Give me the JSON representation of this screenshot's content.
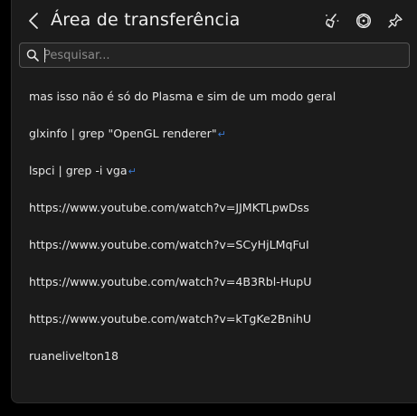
{
  "header": {
    "title": "Área de transferência",
    "back_icon": "back-arrow-icon",
    "clear_icon": "clear-history-icon",
    "configure_icon": "settings-icon",
    "pin_icon": "pin-icon"
  },
  "search": {
    "placeholder": "Pesquisar...",
    "value": ""
  },
  "items": [
    {
      "text": "mas isso não é só do Plasma e sim de um modo geral",
      "newline": false
    },
    {
      "text": "glxinfo | grep \"OpenGL renderer\"",
      "newline": true
    },
    {
      "text": "lspci | grep -i vga",
      "newline": true
    },
    {
      "text": "https://www.youtube.com/watch?v=JJMKTLpwDss",
      "newline": false
    },
    {
      "text": "https://www.youtube.com/watch?v=SCyHjLMqFuI",
      "newline": false
    },
    {
      "text": "https://www.youtube.com/watch?v=4B3Rbl-HupU",
      "newline": false
    },
    {
      "text": "https://www.youtube.com/watch?v=kTgKe2BnihU",
      "newline": false
    },
    {
      "text": "ruanelivelton18",
      "newline": false
    }
  ],
  "newline_symbol": "↵",
  "colors": {
    "background": "#1b1b1b",
    "text": "#e6e6e6",
    "newline_marker": "#3a7bd5",
    "search_border": "#555555"
  }
}
